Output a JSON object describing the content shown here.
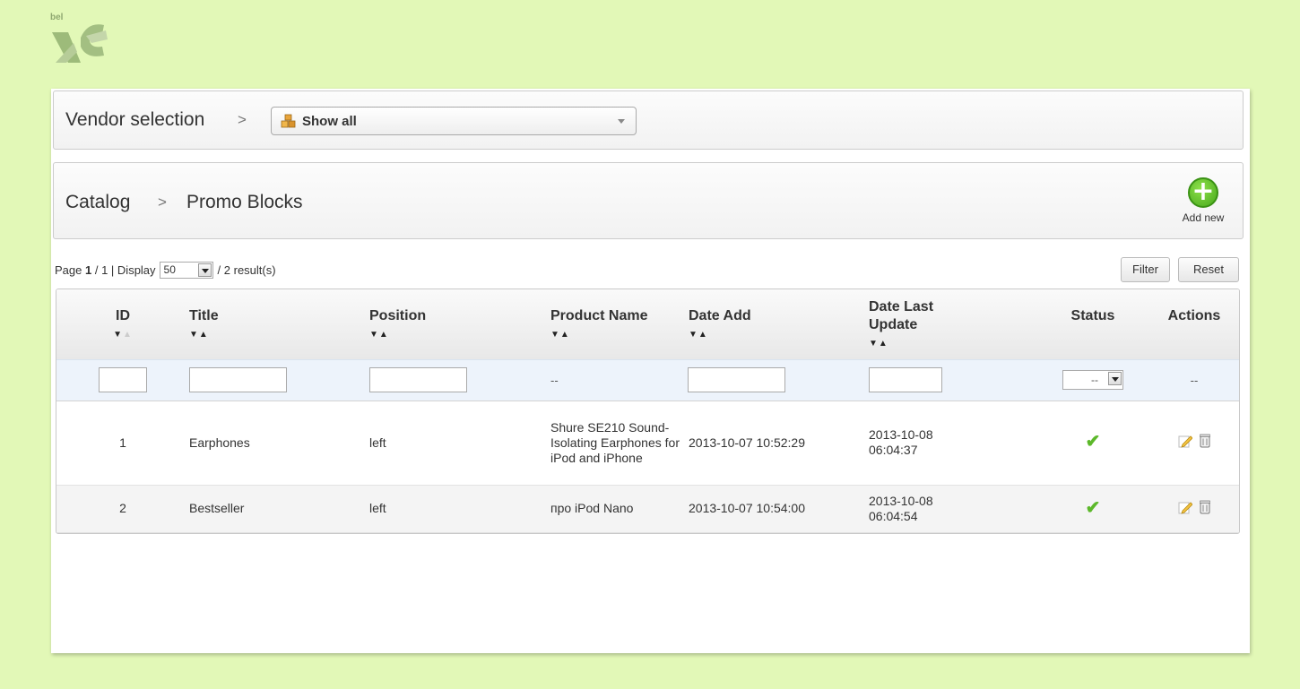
{
  "logo": {
    "small_text": "bel"
  },
  "vendor": {
    "title": "Vendor selection",
    "separator": ">",
    "select_value": "Show all"
  },
  "catalog": {
    "title": "Catalog",
    "separator": ">",
    "subtitle": "Promo Blocks",
    "add_new_label": "Add new"
  },
  "pager": {
    "page_prefix": "Page",
    "current_page": "1",
    "total_pages": "/ 1 | Display",
    "per_page": "50",
    "results": "/ 2 result(s)"
  },
  "toolbar": {
    "filter_label": "Filter",
    "reset_label": "Reset"
  },
  "table": {
    "headers": [
      {
        "label": "ID"
      },
      {
        "label": "Title"
      },
      {
        "label": "Position"
      },
      {
        "label": "Product Name"
      },
      {
        "label": "Date Add"
      },
      {
        "label": "Date Last Update"
      },
      {
        "label": "Status"
      },
      {
        "label": "Actions"
      }
    ],
    "filters": {
      "product_name": "--",
      "status": "--",
      "actions": "--"
    },
    "rows": [
      {
        "id": "1",
        "title": "Earphones",
        "position": "left",
        "product_name": "Shure SE210 Sound-Isolating Earphones for iPod and iPhone",
        "date_add": "2013-10-07 10:52:29",
        "date_update": "2013-10-08 06:04:37",
        "status": "✔"
      },
      {
        "id": "2",
        "title": "Bestseller",
        "position": "left",
        "product_name": "про iPod Nano",
        "date_add": "2013-10-07 10:54:00",
        "date_update": "2013-10-08 06:04:54",
        "status": "✔"
      }
    ]
  },
  "icons": {
    "vendor": "vendor-boxes-icon",
    "add": "plus-circle-icon",
    "edit": "pencil-icon",
    "delete": "trash-icon",
    "status": "checkmark-icon"
  },
  "colors": {
    "background": "#e2f8b7",
    "add_green": "#46a81a",
    "check_green": "#5cb82a"
  }
}
